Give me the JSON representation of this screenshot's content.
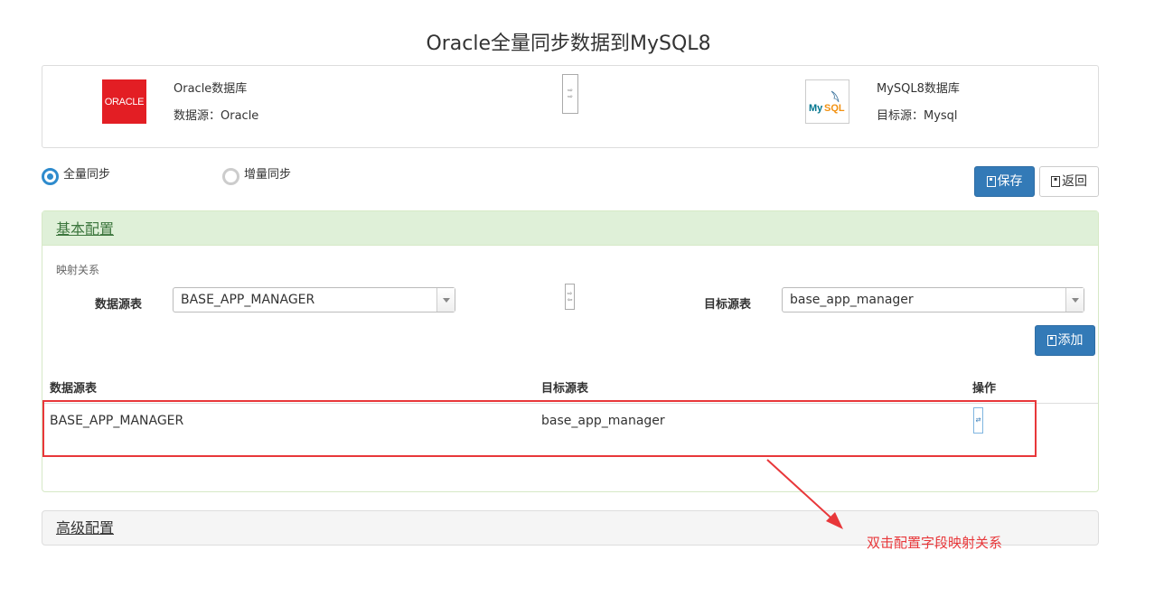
{
  "page": {
    "title": "Oracle全量同步数据到MySQL8"
  },
  "source": {
    "logo_text": "ORACLE",
    "name": "Oracle数据库",
    "detail": "数据源：Oracle",
    "logo_icon": "oracle-logo"
  },
  "target": {
    "logo_text": "MySQL",
    "name": "MySQL8数据库",
    "detail": "目标源：Mysql",
    "logo_icon": "mysql-dolphin-logo"
  },
  "sync_mode": {
    "options": [
      {
        "label": "全量同步",
        "checked": true
      },
      {
        "label": "增量同步",
        "checked": false
      }
    ]
  },
  "toolbar": {
    "save_label": "保存",
    "back_label": "返回",
    "save_icon": "save-icon",
    "back_icon": "back-icon"
  },
  "basic_config": {
    "title": "基本配置",
    "mapping_label": "映射关系",
    "source_table_label": "数据源表",
    "target_table_label": "目标源表",
    "source_table_value": "BASE_APP_MANAGER",
    "target_table_value": "base_app_manager",
    "add_label": "添加",
    "add_icon": "add-icon"
  },
  "mapping_table": {
    "headers": [
      "数据源表",
      "目标源表",
      "操作"
    ],
    "rows": [
      {
        "source": "BASE_APP_MANAGER",
        "target": "base_app_manager",
        "action_icon": "edit-icon"
      }
    ]
  },
  "advanced_config": {
    "title": "高级配置"
  },
  "annotation": {
    "text": "双击配置字段映射关系",
    "color": "#e8373a"
  },
  "colors": {
    "primary": "#337ab7",
    "panel_header": "#dff0d8",
    "panel_title": "#3c763d",
    "oracle_red": "#e31e24"
  }
}
